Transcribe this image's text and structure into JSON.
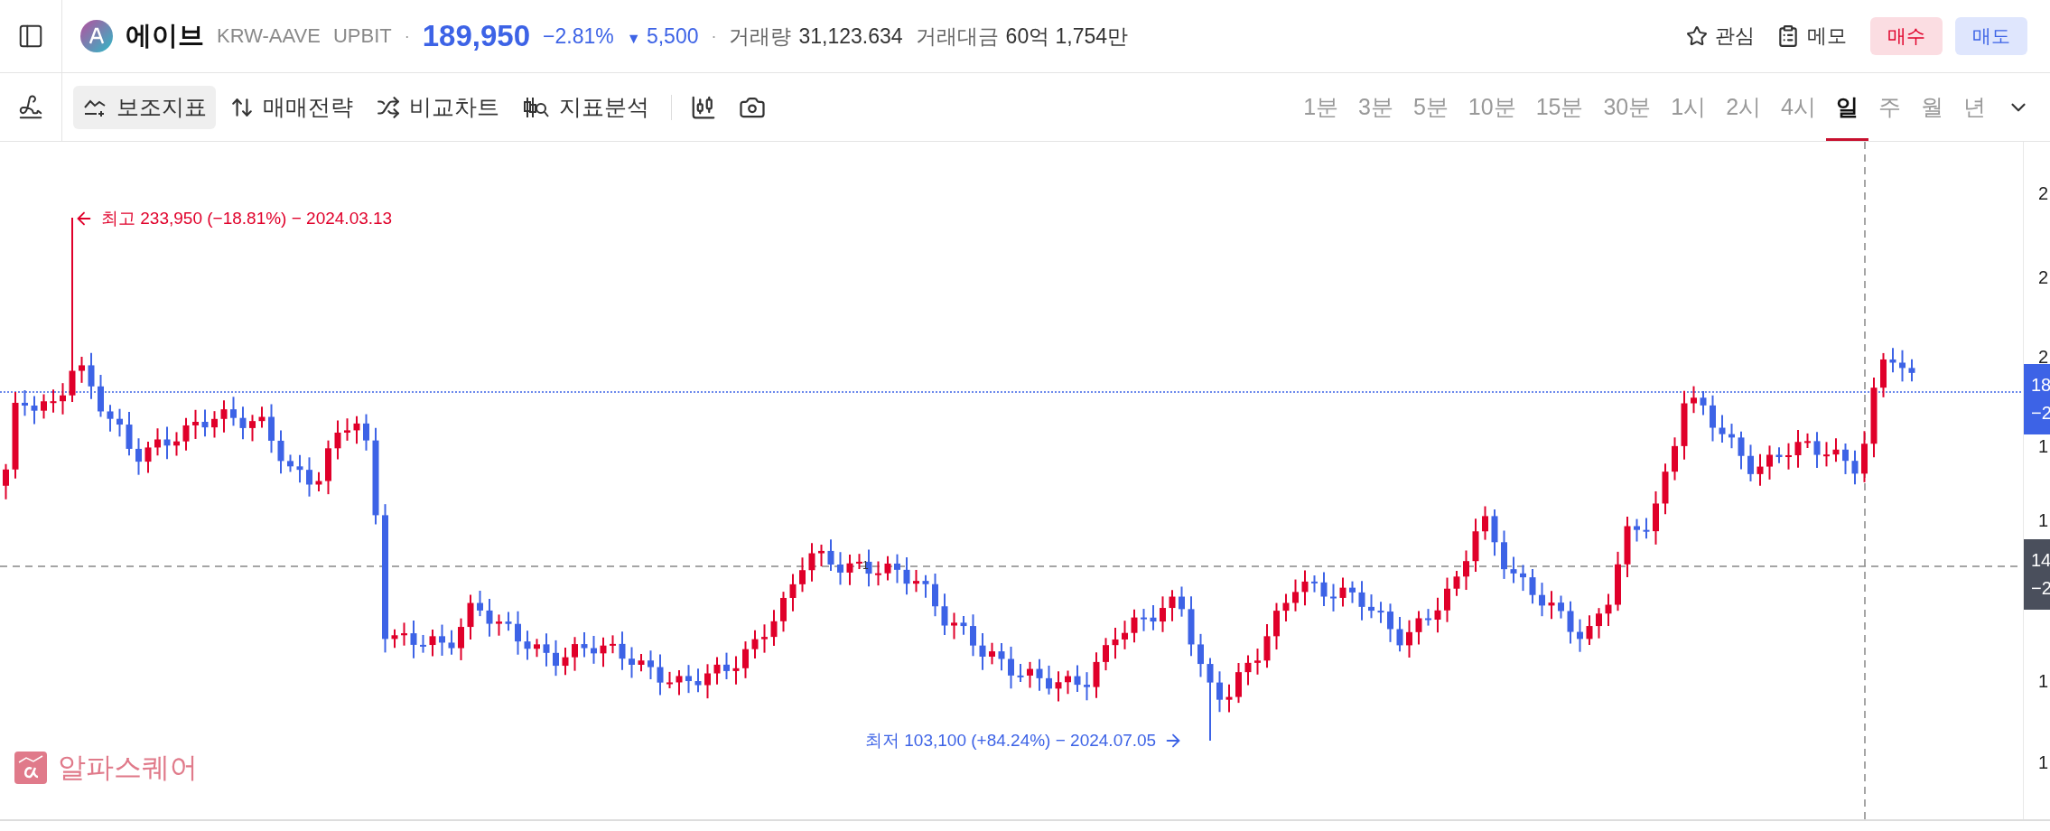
{
  "header": {
    "coin": {
      "name": "에이브",
      "pair": "KRW-AAVE",
      "exchange": "UPBIT",
      "price": "189,950",
      "change_rate": "−2.81%",
      "change_symbol": "▼",
      "change_amount": "5,500",
      "kind": "fall"
    },
    "separators": [
      "·",
      "·"
    ],
    "stats": [
      {
        "label": "거래량",
        "value": "31,123.634"
      },
      {
        "label": "거래대금",
        "value": "60억 1,754만"
      }
    ],
    "actions": [
      {
        "label": "관심",
        "kind": "favorite"
      },
      {
        "label": "메모",
        "kind": "memo"
      }
    ],
    "trade_buttons": [
      {
        "label": "매수",
        "kind": "buy"
      },
      {
        "label": "매도",
        "kind": "sell"
      }
    ]
  },
  "toolbar": {
    "tools": [
      {
        "label": "보조지표",
        "kind": "indicator",
        "selected": true
      },
      {
        "label": "매매전략",
        "kind": "strategy",
        "selected": false
      },
      {
        "label": "비교차트",
        "kind": "compare",
        "selected": false
      },
      {
        "label": "지표분석",
        "kind": "analysis",
        "selected": false
      }
    ],
    "intervals": [
      {
        "label": "1분",
        "selected": false
      },
      {
        "label": "3분",
        "selected": false
      },
      {
        "label": "5분",
        "selected": false
      },
      {
        "label": "10분",
        "selected": false
      },
      {
        "label": "15분",
        "selected": false
      },
      {
        "label": "30분",
        "selected": false
      },
      {
        "label": "1시",
        "selected": false
      },
      {
        "label": "2시",
        "selected": false
      },
      {
        "label": "4시",
        "selected": false
      },
      {
        "label": "일",
        "selected": true
      },
      {
        "label": "주",
        "selected": false
      },
      {
        "label": "월",
        "selected": false
      },
      {
        "label": "년",
        "selected": false
      }
    ]
  },
  "chart": {
    "high_marker": "최고 233,950 (−18.81%) − 2024.03.13",
    "low_marker": "최저 103,100 (+84.24%) − 2024.07.05",
    "event_marker": "1",
    "brand": "알파스퀘어",
    "axis_labels": [
      "2",
      "2",
      "2",
      "1",
      "1",
      "1",
      "1"
    ],
    "price_tag": {
      "line1": "18",
      "line2": "−2"
    },
    "crosshair_tag": {
      "line1": "14",
      "line2": "−2"
    }
  }
}
